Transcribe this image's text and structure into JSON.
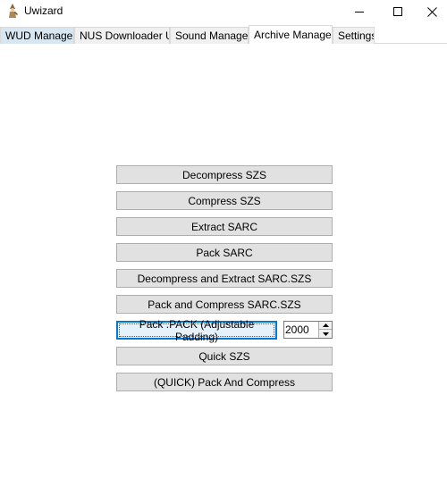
{
  "window": {
    "title": "Uwizard",
    "app_icon": "wizard-figure-icon",
    "controls": [
      "minimize-icon",
      "maximize-icon",
      "close-icon"
    ]
  },
  "tabs": [
    {
      "label": "WUD Manager",
      "state": "hover"
    },
    {
      "label": "NUS Downloader U",
      "state": "normal"
    },
    {
      "label": "Sound Manager",
      "state": "normal"
    },
    {
      "label": "Archive Manager",
      "state": "active"
    },
    {
      "label": "Settings",
      "state": "normal"
    }
  ],
  "archive_manager": {
    "decompress_szs": "Decompress SZS",
    "compress_szs": "Compress SZS",
    "extract_sarc": "Extract SARC",
    "pack_sarc": "Pack SARC",
    "decompress_extract_sarc_szs": "Decompress and Extract SARC.SZS",
    "pack_compress_sarc_szs": "Pack and Compress SARC.SZS",
    "pack_pack": "Pack .PACK (Adjustable Padding)",
    "padding_value": "2000",
    "quick_szs": "Quick SZS",
    "quick_pack_compress": "(QUICK) Pack And Compress"
  },
  "colors": {
    "focus_accent": "#0078d7",
    "hover_tab": "#d8e6f2",
    "button_face": "#e1e1e1"
  }
}
